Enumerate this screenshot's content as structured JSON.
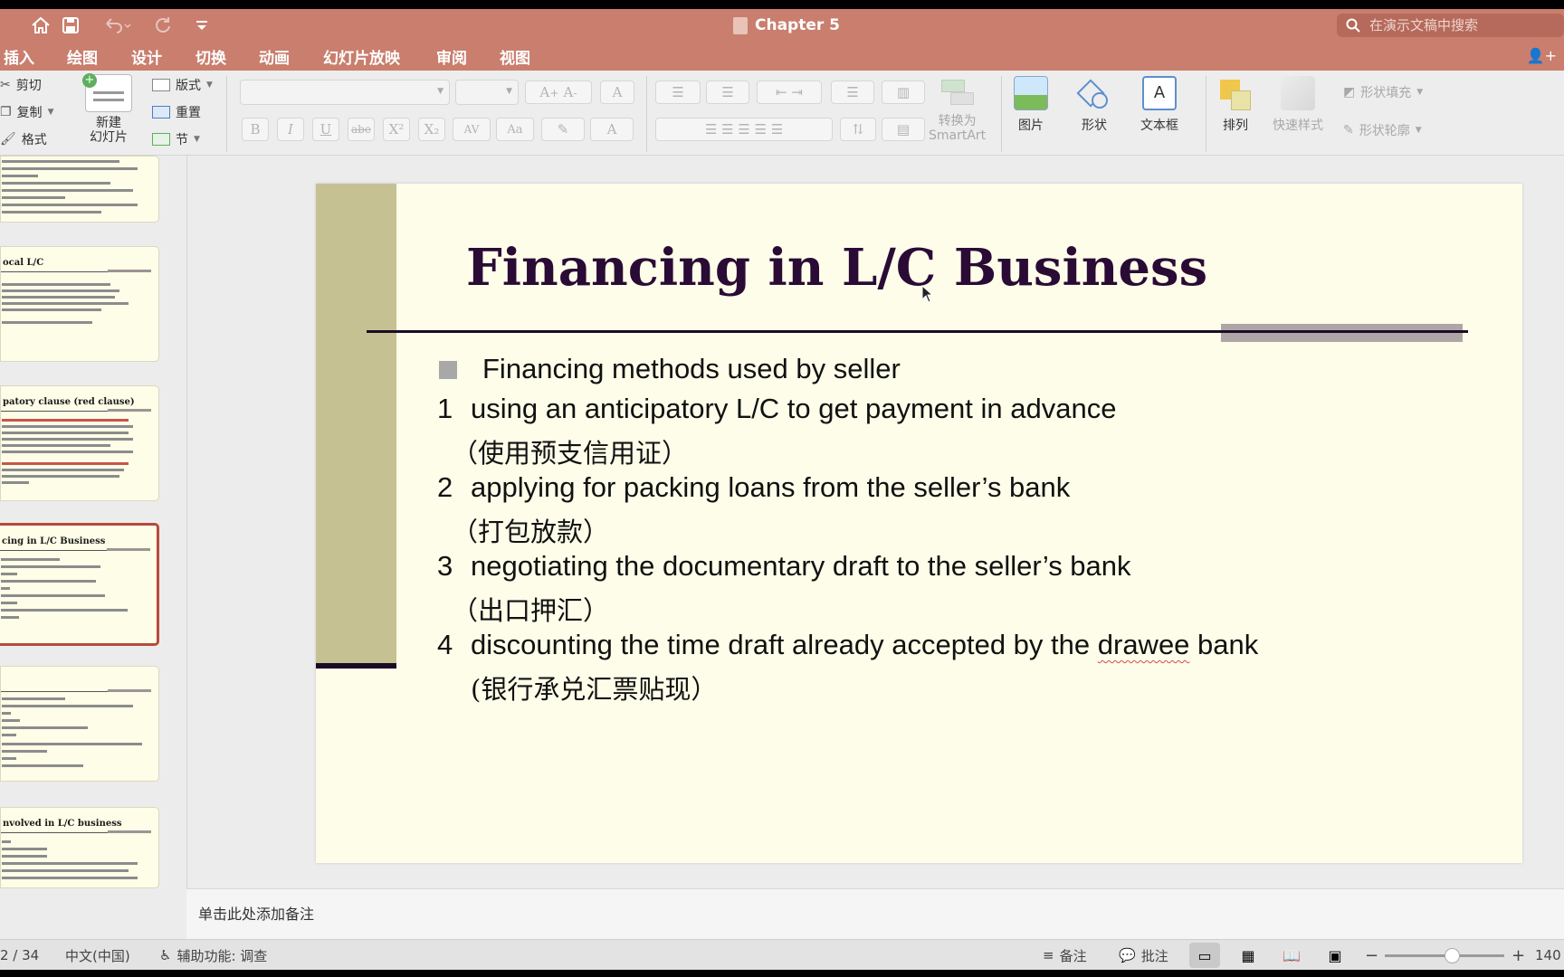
{
  "titlebar": {
    "doc_title": "Chapter 5",
    "search_placeholder": "在演示文稿中搜索"
  },
  "menubar": {
    "items": [
      "插入",
      "绘图",
      "设计",
      "切换",
      "动画",
      "幻灯片放映",
      "审阅",
      "视图"
    ]
  },
  "ribbon": {
    "cut": "剪切",
    "copy": "复制",
    "format": "格式",
    "new_slide_line1": "新建",
    "new_slide_line2": "幻灯片",
    "layout": "版式",
    "reset": "重置",
    "section": "节",
    "convert_smartart_line1": "转换为",
    "convert_smartart_line2": "SmartArt",
    "picture": "图片",
    "shape": "形状",
    "textbox": "文本框",
    "arrange": "排列",
    "quick_styles": "快速样式",
    "shape_fill": "形状填充",
    "shape_outline": "形状轮廓",
    "format_buttons": [
      "B",
      "I",
      "U",
      "abe",
      "X²",
      "X₂",
      "AV",
      "Aa",
      "A"
    ]
  },
  "thumbnails": [
    {
      "title": "",
      "selected": false
    },
    {
      "title": "ocal  L/C",
      "selected": false
    },
    {
      "title": "patory clause (red clause)",
      "selected": false
    },
    {
      "title": "cing in L/C Business",
      "selected": true
    },
    {
      "title": "",
      "selected": false
    },
    {
      "title": "nvolved in L/C business",
      "selected": false
    }
  ],
  "slide": {
    "title": "Financing in L/C Business",
    "heading": "Financing methods used by seller",
    "items": [
      {
        "num": "1",
        "text": "using an anticipatory L/C to get payment in advance",
        "cn": "（使用预支信用证）"
      },
      {
        "num": "2",
        "text": "applying for packing loans from the seller’s bank",
        "cn": "（打包放款）"
      },
      {
        "num": "3",
        "text": "negotiating the documentary draft to the seller’s bank",
        "cn": "（出口押汇）"
      },
      {
        "num": "4",
        "text_before": "discounting the time draft already accepted by the ",
        "text_marked": "drawee",
        "text_after": " bank",
        "cn": "(银行承兑汇票贴现）"
      }
    ]
  },
  "notes": {
    "placeholder": "单击此处添加备注"
  },
  "status": {
    "page": "2 / 34",
    "language": "中文(中国)",
    "accessibility": "辅助功能: 调查",
    "notes_btn": "备注",
    "comments_btn": "批注",
    "zoom": "140"
  },
  "colors": {
    "titlebar": "#c97e6e",
    "slide_bg": "#fdfde9",
    "slide_bar": "#c6c193",
    "slide_title": "#2a0b35",
    "selection": "#b74a3a"
  }
}
